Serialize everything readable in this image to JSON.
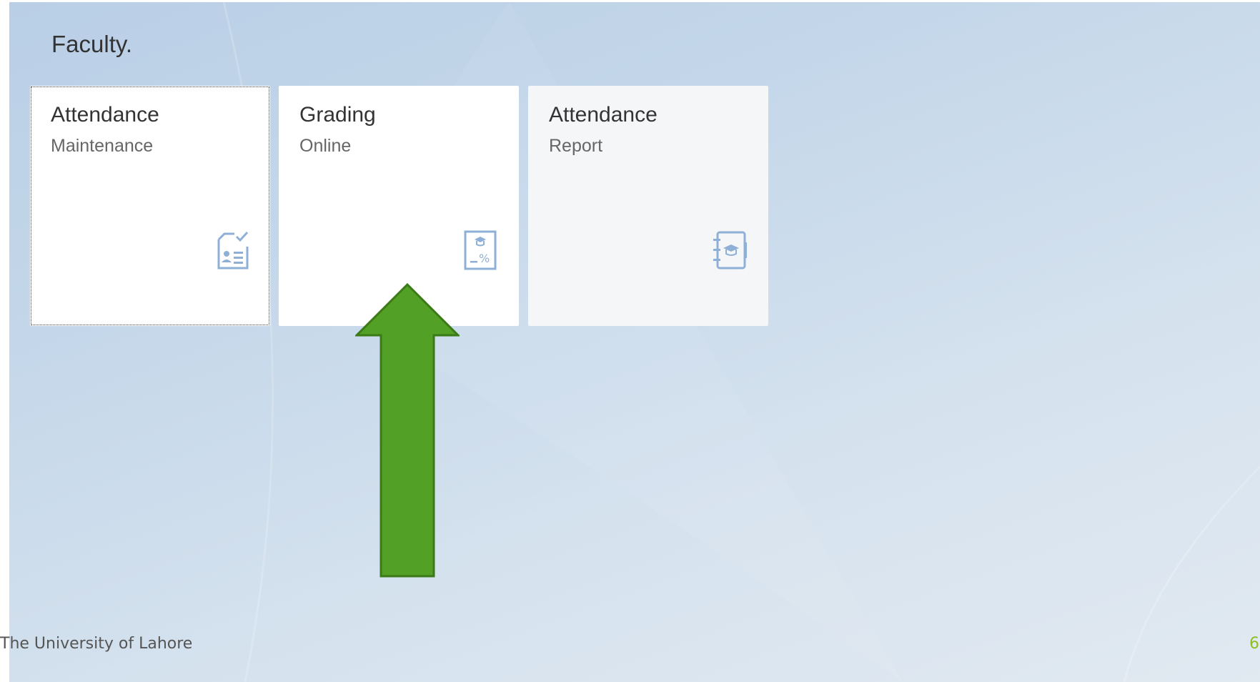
{
  "group": {
    "title": "Faculty."
  },
  "tiles": [
    {
      "title": "Attendance",
      "subtitle": "Maintenance",
      "icon": "attendance-form-icon",
      "focused": true
    },
    {
      "title": "Grading",
      "subtitle": "Online",
      "icon": "grade-percent-icon",
      "focused": false
    },
    {
      "title": "Attendance",
      "subtitle": "Report",
      "icon": "graduation-notebook-icon",
      "focused": false
    }
  ],
  "footer": {
    "organization": "The University of Lahore",
    "page_number": "6"
  },
  "colors": {
    "icon": "#8fb0d6",
    "arrow_fill": "#52a025",
    "arrow_stroke": "#3a7a17",
    "page_number": "#8cbf1f"
  }
}
